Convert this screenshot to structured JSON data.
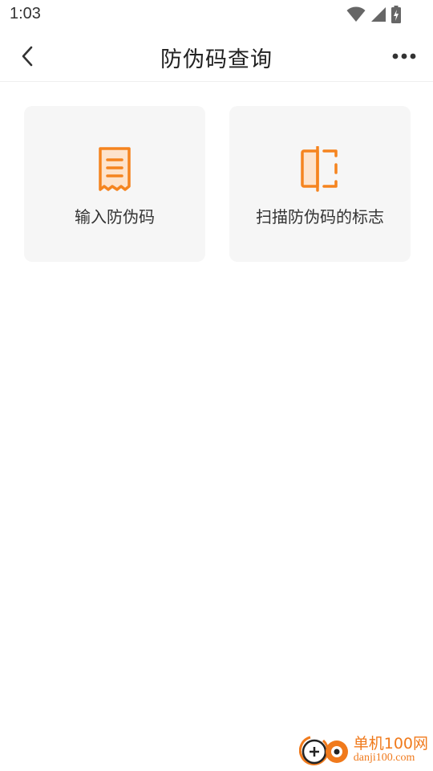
{
  "status_bar": {
    "time": "1:03",
    "icons": [
      "wifi-icon",
      "signal-icon",
      "battery-charging-icon"
    ]
  },
  "nav": {
    "title": "防伪码查询",
    "back_icon": "chevron-left-icon",
    "more_icon": "more-dots-icon"
  },
  "options": [
    {
      "label": "输入防伪码",
      "icon": "receipt-icon"
    },
    {
      "label": "扫描防伪码的标志",
      "icon": "scan-frame-icon"
    }
  ],
  "colors": {
    "accent": "#f5841f",
    "accent_light": "#fde3cc",
    "card_bg": "#f6f6f6",
    "title_text": "#222222"
  },
  "watermark": {
    "logo_icon": "danji-logo-icon",
    "name": "单机100网",
    "url": "danji100.com"
  }
}
